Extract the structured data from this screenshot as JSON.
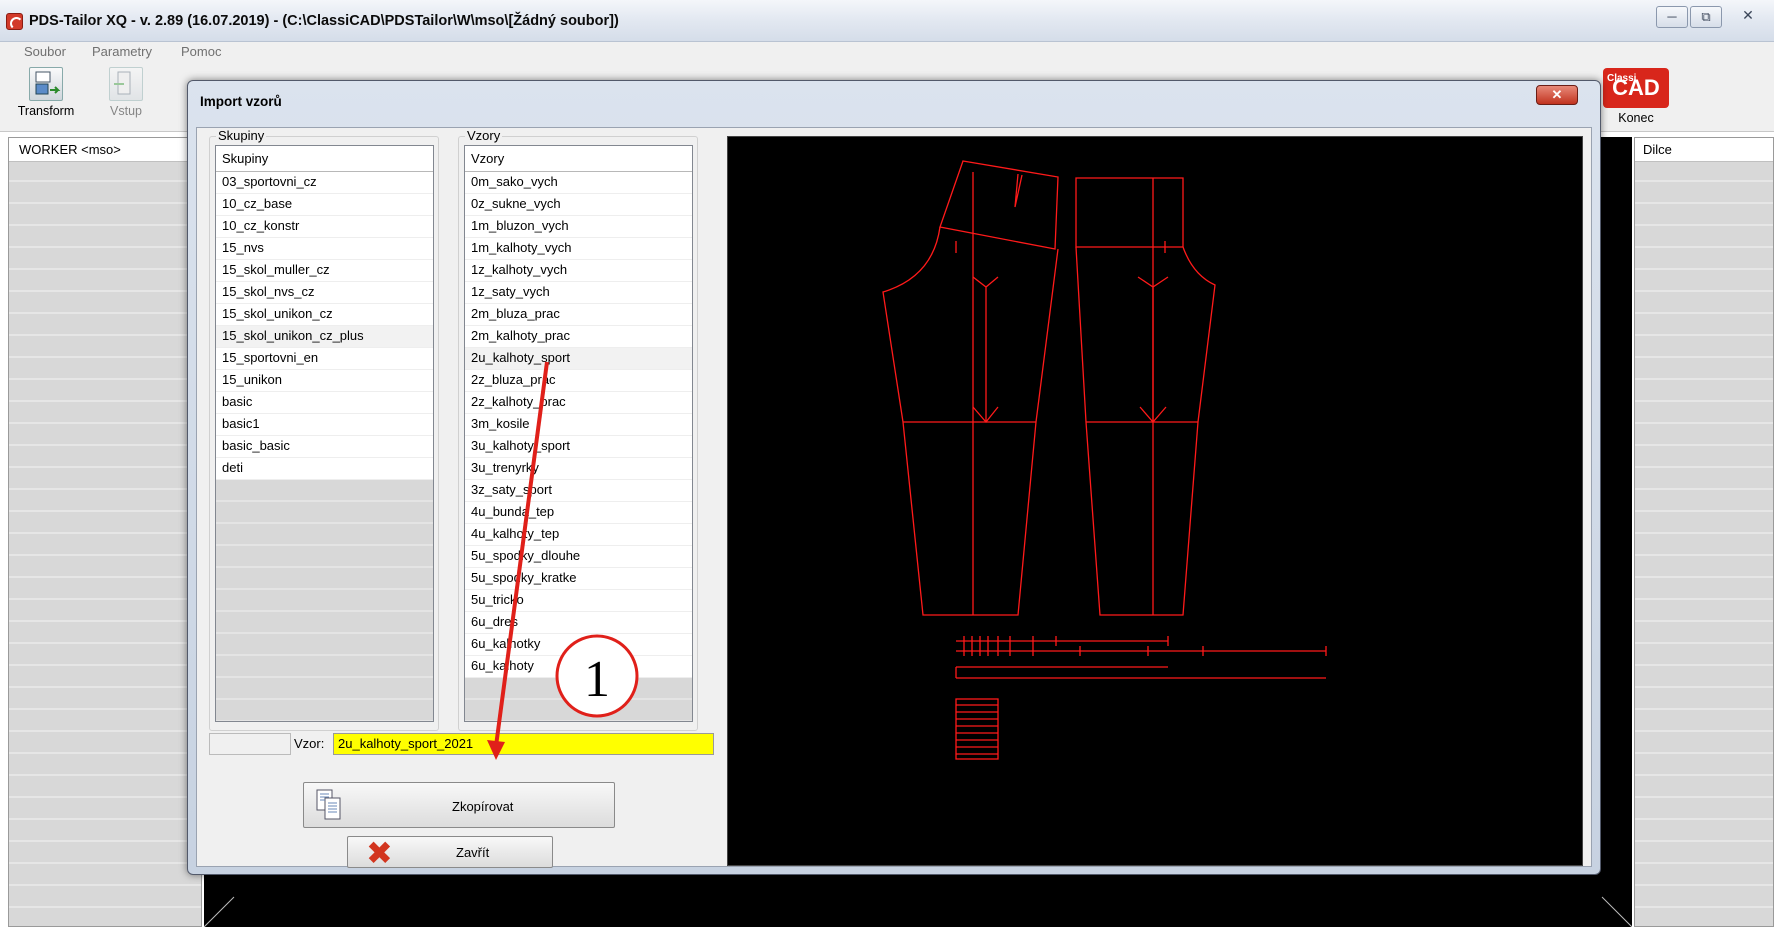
{
  "window": {
    "title": "PDS-Tailor XQ - v. 2.89 (16.07.2019) - (C:\\ClassiCAD\\PDSTailor\\W\\mso\\[Žádný soubor])",
    "min_glyph": "─",
    "max_glyph": "⧉",
    "close_glyph": "✕"
  },
  "menu": {
    "soubor": "Soubor",
    "parametry": "Parametry",
    "pomoc": "Pomoc"
  },
  "toolbar": {
    "transform": "Transform",
    "vstup": "Vstup",
    "konec": "Konec",
    "logo_top": "Classi",
    "logo_main": "CAD"
  },
  "worker_panel": {
    "header": "WORKER <mso>"
  },
  "dilce_panel": {
    "header": "Dilce"
  },
  "dialog": {
    "title": "Import vzorů",
    "close_glyph": "✕",
    "skupiny": {
      "caption": "Skupiny",
      "header": "Skupiny",
      "items": [
        "03_sportovni_cz",
        "10_cz_base",
        "10_cz_konstr",
        "15_nvs",
        "15_skol_muller_cz",
        "15_skol_nvs_cz",
        "15_skol_unikon_cz",
        "15_skol_unikon_cz_plus",
        "15_sportovni_en",
        "15_unikon",
        "basic",
        "basic1",
        "basic_basic",
        "deti"
      ],
      "selected_index": 7
    },
    "vzory": {
      "caption": "Vzory",
      "header": "Vzory",
      "items": [
        "0m_sako_vych",
        "0z_sukne_vych",
        "1m_bluzon_vych",
        "1m_kalhoty_vych",
        "1z_kalhoty_vych",
        "1z_saty_vych",
        "2m_bluza_prac",
        "2m_kalhoty_prac",
        "2u_kalhoty_sport",
        "2z_bluza_prac",
        "2z_kalhoty_prac",
        "3m_kosile",
        "3u_kalhoty_sport",
        "3u_trenyrky",
        "3z_saty_sport",
        "4u_bunda_tep",
        "4u_kalhoty_tep",
        "5u_spodky_dlouhe",
        "5u_spodky_kratke",
        "5u_tricko",
        "6u_dres",
        "6u_kalhotky",
        "6u_kalhoty"
      ],
      "selected_index": 8
    },
    "vzor_label": "Vzor:",
    "vzor_value": "2u_kalhoty_sport_2021",
    "btn_copy": "Zkopírovat",
    "btn_close": "Zavřít",
    "btn_close_glyph": "✖"
  },
  "annotation": {
    "number": "1",
    "color": "#e0201a"
  },
  "colors": {
    "pattern_line": "#ff1a1a",
    "highlight": "#ffff00",
    "canvas": "#000000"
  }
}
